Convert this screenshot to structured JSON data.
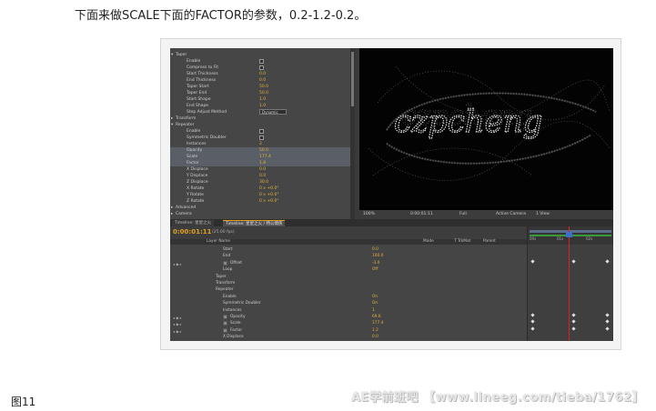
{
  "page": {
    "caption": "下面来做SCALE下面的FACTOR的参数，0.2-1.2-0.2。",
    "figure_label": "图11",
    "watermark": "AE学前班吧 【www.lineeg.com/tieba/1762】"
  },
  "effect_controls": {
    "rows": [
      {
        "label": "Taper",
        "indent": 0,
        "twirl": "▾"
      },
      {
        "label": "Enable",
        "indent": 2,
        "check": true
      },
      {
        "label": "Compress to Fit",
        "indent": 2,
        "check": true
      },
      {
        "label": "Start Thickness",
        "indent": 2,
        "value": "0.0"
      },
      {
        "label": "End Thickness",
        "indent": 2,
        "value": "0.0"
      },
      {
        "label": "Taper Start",
        "indent": 2,
        "value": "50.0"
      },
      {
        "label": "Taper End",
        "indent": 2,
        "value": "50.0"
      },
      {
        "label": "Start Shape",
        "indent": 2,
        "value": "1.0"
      },
      {
        "label": "End Shape",
        "indent": 2,
        "value": "1.0"
      },
      {
        "label": "Step Adjust Method",
        "indent": 2,
        "dropdown": "Dynamic"
      },
      {
        "label": "Transform",
        "indent": 0,
        "twirl": "▸"
      },
      {
        "label": "Repeater",
        "indent": 0,
        "twirl": "▾"
      },
      {
        "label": "Enable",
        "indent": 2,
        "check": true
      },
      {
        "label": "Symmetric Doubler",
        "indent": 2,
        "check": true
      },
      {
        "label": "Instances",
        "indent": 2,
        "value": "2"
      },
      {
        "label": "Opacity",
        "indent": 2,
        "value": "50.0",
        "highlight": true
      },
      {
        "label": "Scale",
        "indent": 2,
        "value": "177.4",
        "highlight": true
      },
      {
        "label": "Factor",
        "indent": 2,
        "value": "1.8",
        "highlight": true
      },
      {
        "label": "X Displace",
        "indent": 2,
        "value": "0.0"
      },
      {
        "label": "Y Displace",
        "indent": 2,
        "value": "0.0"
      },
      {
        "label": "Z Displace",
        "indent": 2,
        "value": "30.0"
      },
      {
        "label": "X Rotate",
        "indent": 2,
        "value": "0 x +0.0°"
      },
      {
        "label": "Y Rotate",
        "indent": 2,
        "value": "0 x +0.0°"
      },
      {
        "label": "Z Rotate",
        "indent": 2,
        "value": "0 x +0.0°"
      },
      {
        "label": "Advanced",
        "indent": 0,
        "twirl": "▸"
      },
      {
        "label": "Camera",
        "indent": 0,
        "twirl": "▸"
      }
    ]
  },
  "comp_viewer": {
    "text": "czpcheng",
    "viewbar": {
      "zoom": "100%",
      "timecode": "0:00:01:11",
      "resolution": "Full",
      "camera": "Active Camera",
      "views": "1 View"
    }
  },
  "timeline": {
    "tabs": [
      {
        "label": "Timeline: 星星之火",
        "active": false
      },
      {
        "label": "Timeline: 星星之火 / 特公情侠",
        "active": true
      }
    ],
    "current_time": "0:00:01:11",
    "fps": "(25.00 fps)",
    "columns": {
      "layer_name": "Layer Name",
      "mode": "Mode",
      "trkmat": "T TrkMat",
      "parent": "Parent"
    },
    "ruler_ticks": [
      "00s",
      "01s",
      "02s"
    ],
    "rows": [
      {
        "name": "Start",
        "indent": 58,
        "value": "0.0",
        "swatch": false
      },
      {
        "name": "End",
        "indent": 58,
        "value": "100.0",
        "swatch": false
      },
      {
        "name": "Offset",
        "indent": 66,
        "value": "-3.0",
        "swatch": true,
        "keyed": true
      },
      {
        "name": "Loop",
        "indent": 58,
        "value": "Off",
        "swatch": false
      },
      {
        "name": "Taper",
        "indent": 50,
        "value": "",
        "swatch": false
      },
      {
        "name": "Transform",
        "indent": 50,
        "value": "",
        "swatch": false
      },
      {
        "name": "Repeater",
        "indent": 50,
        "value": "",
        "swatch": false
      },
      {
        "name": "Enable",
        "indent": 58,
        "value": "On",
        "swatch": false
      },
      {
        "name": "Symmetric Doubler",
        "indent": 58,
        "value": "On",
        "swatch": false
      },
      {
        "name": "Instances",
        "indent": 58,
        "value": "1",
        "swatch": false
      },
      {
        "name": "Opacity",
        "indent": 66,
        "value": "69.6",
        "swatch": true,
        "keyed": true
      },
      {
        "name": "Scale",
        "indent": 66,
        "value": "177.4",
        "swatch": true,
        "keyed": true
      },
      {
        "name": "Factor",
        "indent": 66,
        "value": "1.2",
        "swatch": true,
        "keyed": true
      },
      {
        "name": "X Displace",
        "indent": 58,
        "value": "0.0",
        "swatch": false
      }
    ]
  },
  "colors": {
    "accent": "#e0a020",
    "value": "#e0b43a",
    "cti": "#e02020"
  }
}
